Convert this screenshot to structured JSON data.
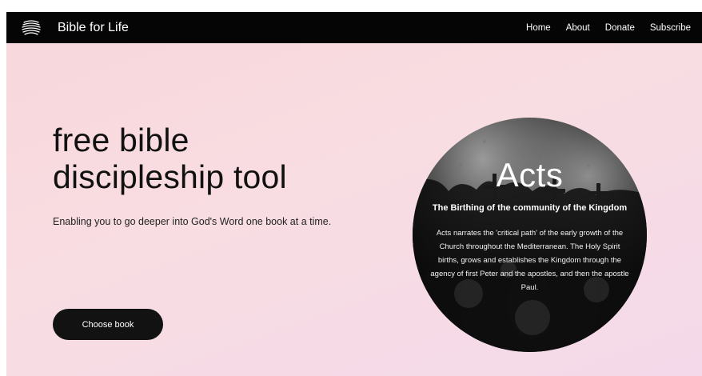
{
  "navbar": {
    "brand": "Bible for Life",
    "logo_icon": "wave-stack-icon",
    "links": [
      "Home",
      "About",
      "Donate",
      "Subscribe"
    ]
  },
  "hero": {
    "title_line1": "free bible",
    "title_line2": "discipleship tool",
    "subtitle": "Enabling you to go deeper into God's Word one book at a time.",
    "cta_label": "Choose book"
  },
  "book": {
    "title": "Acts",
    "subtitle": "The Birthing of the community of the Kingdom",
    "description": "Acts narrates the 'critical path' of the early growth of the Church throughout the Mediterranean. The Holy Spirit births, grows and establishes the Kingdom through the agency of first Peter and the apostles, and then the apostle Paul."
  },
  "colors": {
    "navbar_bg": "#050505",
    "page_bg_start": "#f7d7db",
    "page_bg_end": "#f4d9ea",
    "button_bg": "#121212",
    "text_dark": "#111111"
  }
}
